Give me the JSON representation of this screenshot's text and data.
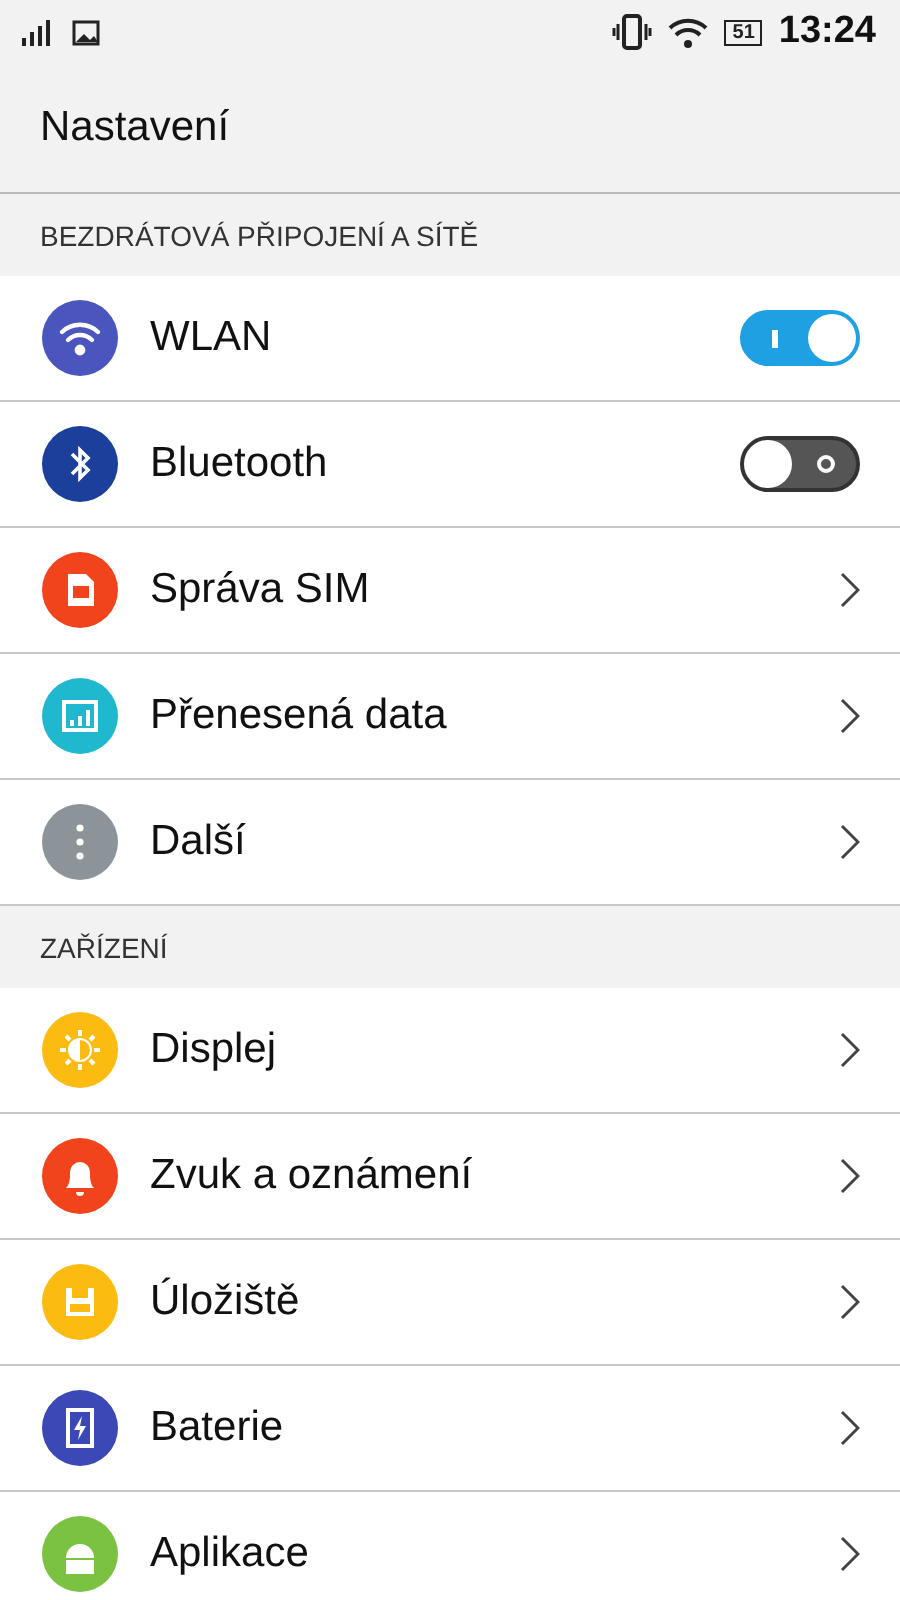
{
  "status_bar": {
    "battery": "51",
    "time": "13:24"
  },
  "title": "Nastavení",
  "sections": [
    {
      "header": "BEZDRÁTOVÁ PŘIPOJENÍ A SÍTĚ",
      "items": [
        {
          "label": "WLAN",
          "kind": "toggle",
          "on": true,
          "color": "#4a55bd"
        },
        {
          "label": "Bluetooth",
          "kind": "toggle",
          "on": false,
          "color": "#1c3f9c"
        },
        {
          "label": "Správa SIM",
          "kind": "link",
          "color": "#f2441c"
        },
        {
          "label": "Přenesená data",
          "kind": "link",
          "color": "#1fb8cf"
        },
        {
          "label": "Další",
          "kind": "link",
          "color": "#8d9499"
        }
      ]
    },
    {
      "header": "ZAŘÍZENÍ",
      "items": [
        {
          "label": "Displej",
          "kind": "link",
          "color": "#fbbb10"
        },
        {
          "label": "Zvuk a oznámení",
          "kind": "link",
          "color": "#f2441c"
        },
        {
          "label": "Úložiště",
          "kind": "link",
          "color": "#fbbb10"
        },
        {
          "label": "Baterie",
          "kind": "link",
          "color": "#3b48b5"
        },
        {
          "label": "Aplikace",
          "kind": "link",
          "color": "#7cc242"
        }
      ]
    }
  ]
}
